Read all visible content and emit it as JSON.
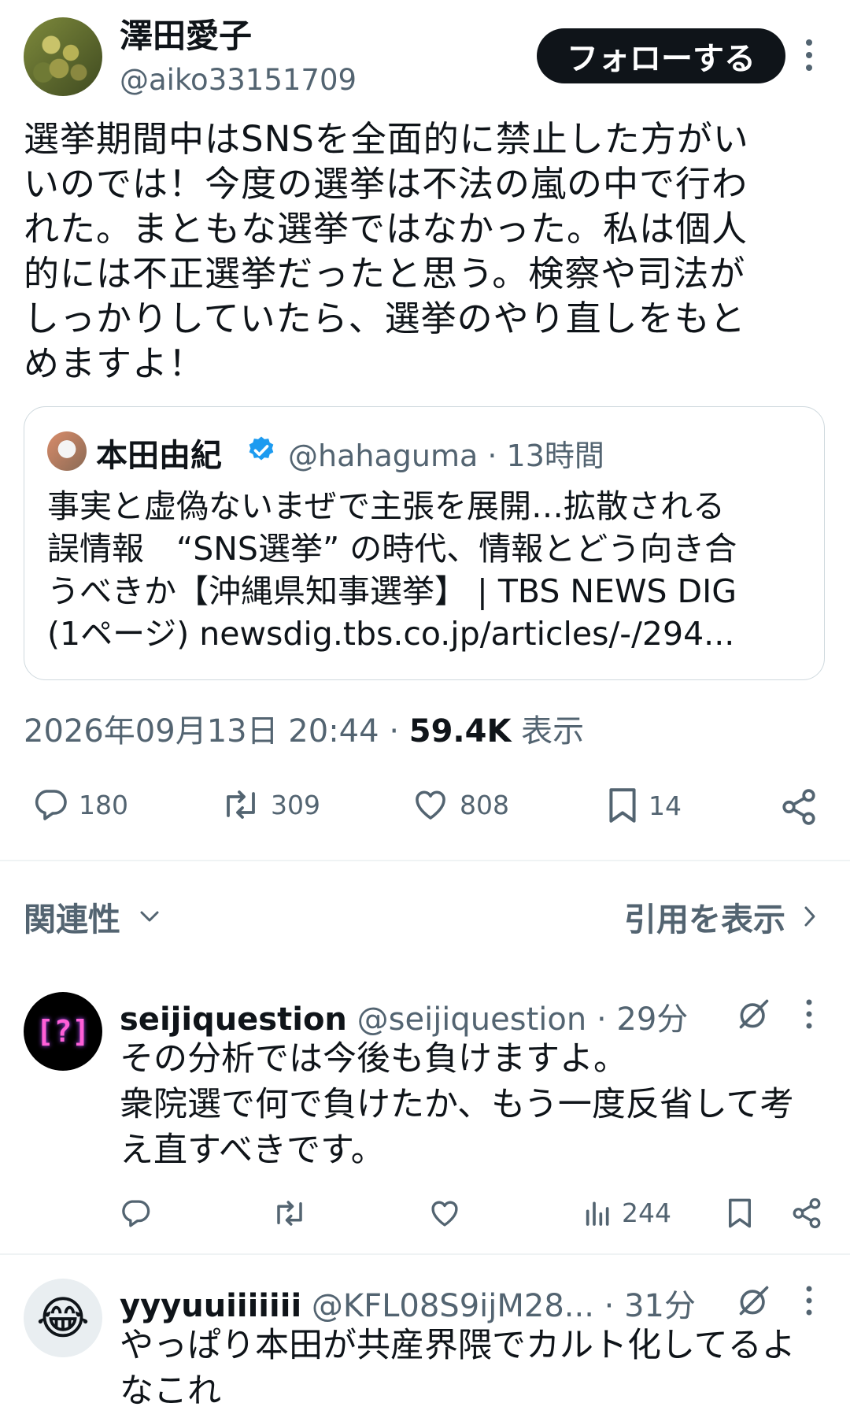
{
  "author": {
    "display_name": "澤田愛子",
    "handle": "@aiko33151709",
    "follow_label": "フォローする"
  },
  "post": {
    "lines": [
      "選挙期間中はSNSを全面的に禁止した方がい",
      "いのでは！今度の選挙は不法の嵐の中で行わ",
      "れた。まともな選挙ではなかった。私は個人",
      "的には不正選挙だったと思う。検察や司法が",
      "しっかりしていたら、選挙のやり直しをもと",
      "めますよ！"
    ],
    "timestamp": "2026年09月13日 20:44",
    "views_count": "59.4K",
    "views_label": "表示",
    "separator": "·"
  },
  "quote": {
    "name": "本田由紀",
    "handle": "@hahaguma",
    "time": "13時間",
    "lines": [
      "事実と虚偽ないまぜで主張を展開…拡散される",
      "誤情報　“SNS選挙” の時代、情報とどう向き合",
      "うべきか【沖縄県知事選挙】 | TBS NEWS DIG",
      "(1ページ) newsdig.tbs.co.jp/articles/-/294..."
    ]
  },
  "actions": {
    "replies": "180",
    "reposts": "309",
    "likes": "808",
    "bookmarks": "14"
  },
  "sort": {
    "label": "関連性",
    "quotes_label": "引用を表示"
  },
  "replies": [
    {
      "name": "seijiquestion",
      "handle": "@seijiquestion",
      "time": "29分",
      "avatar_text": "[?]",
      "lines": [
        "その分析では今後も負けますよ。",
        "衆院選で何で負けたか、もう一度反省して考",
        "え直すべきです。"
      ],
      "views": "244"
    },
    {
      "name": "yyyuuiiiiiii",
      "handle": "@KFL08S9ijM28...",
      "time": "31分",
      "avatar_emoji": "😂",
      "lines": [
        "やっぱり本田が共産界隈でカルト化してるよ",
        "なこれ"
      ]
    }
  ],
  "colors": {
    "text": "#0f1419",
    "secondary": "#536471",
    "verified": "#1d9bf0",
    "border": "#cfd9de"
  }
}
